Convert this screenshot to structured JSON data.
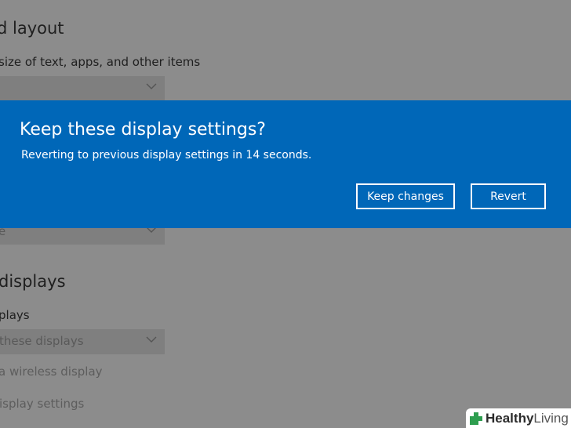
{
  "background": {
    "scale_heading": "d layout",
    "scale_label": "size of text, apps, and other items",
    "scale_dropdown_value": "",
    "orientation_dropdown_value": "e",
    "multiple_displays_heading": "displays",
    "multiple_displays_label": "plays",
    "multiple_displays_dropdown_value": "these displays",
    "wireless_link": "a wireless display",
    "advanced_link": "isplay settings"
  },
  "dialog": {
    "title": "Keep these display settings?",
    "message": "Reverting to previous display settings in 14 seconds.",
    "keep_button": "Keep changes",
    "revert_button": "Revert"
  },
  "watermark": {
    "brand_bold": "Healthy",
    "brand_light": "Living"
  },
  "colors": {
    "dialog_background": "#0067b8",
    "overlay_gray": "#8c8c8c",
    "watermark_green": "#2e9e4f"
  }
}
